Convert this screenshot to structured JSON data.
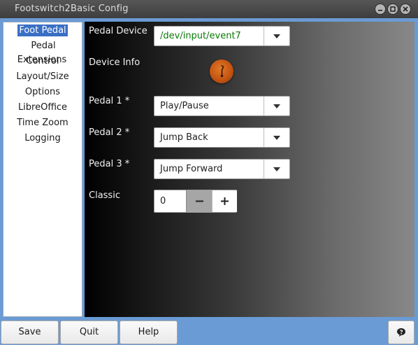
{
  "window": {
    "title": "Footswitch2Basic Config"
  },
  "sidebar": {
    "items": [
      {
        "label": "Foot Pedal",
        "selected": true
      },
      {
        "label": "Pedal Extensions"
      },
      {
        "label": "Control"
      },
      {
        "label": "Layout/Size"
      },
      {
        "label": "Options"
      },
      {
        "label": "LibreOffice"
      },
      {
        "label": "Time Zoom"
      },
      {
        "label": "Logging"
      }
    ]
  },
  "form": {
    "pedal_device": {
      "label": "Pedal Device",
      "value": "/dev/input/event7"
    },
    "device_info": {
      "label": "Device Info",
      "icon": "thermometer-info-icon"
    },
    "pedal1": {
      "label": "Pedal 1 *",
      "value": "Play/Pause"
    },
    "pedal2": {
      "label": "Pedal 2 *",
      "value": "Jump Back"
    },
    "pedal3": {
      "label": "Pedal 3 *",
      "value": "Jump Forward"
    },
    "classic": {
      "label": "Classic",
      "value": "0"
    }
  },
  "buttons": {
    "save": "Save",
    "quit": "Quit",
    "help": "Help"
  },
  "colors": {
    "accent": "#3a6fc4",
    "frame": "#6a9bd4",
    "device_text": "#0a7a0a",
    "info_orange": "#c65512"
  }
}
